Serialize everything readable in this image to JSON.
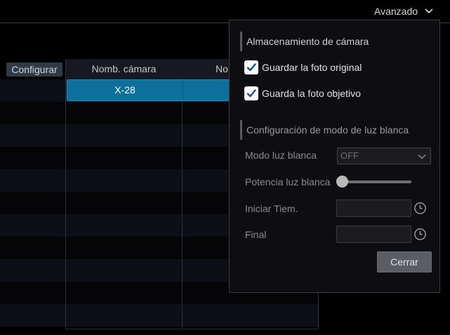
{
  "topbar": {
    "advanced_label": "Avanzado",
    "advanced_icon": "chevron-down-icon"
  },
  "table": {
    "config_header": "Configurar",
    "headers": [
      "Nomb. cámara",
      "No"
    ],
    "selected_row": {
      "camera_name": "X-28"
    },
    "row_count": 11
  },
  "popup": {
    "storage_section_title": "Almacenamiento de cámara",
    "checkboxes": [
      {
        "label": "Guardar la foto original",
        "checked": true
      },
      {
        "label": "Guarda la foto objetivo",
        "checked": true
      }
    ],
    "white_light_section_title": "Configuración de modo de luz blanca",
    "mode_label": "Modo luz blanca",
    "mode_value": "OFF",
    "power_label": "Potencia luz blanca",
    "power_level": 0,
    "start_label": "Iniciar Tiem.",
    "start_value": "",
    "end_label": "Final",
    "end_value": "",
    "close_label": "Cerrar"
  },
  "colors": {
    "selected_row": "#0c6f9c",
    "checkbox": "#ffffff",
    "close_button": "#5a5d62"
  }
}
